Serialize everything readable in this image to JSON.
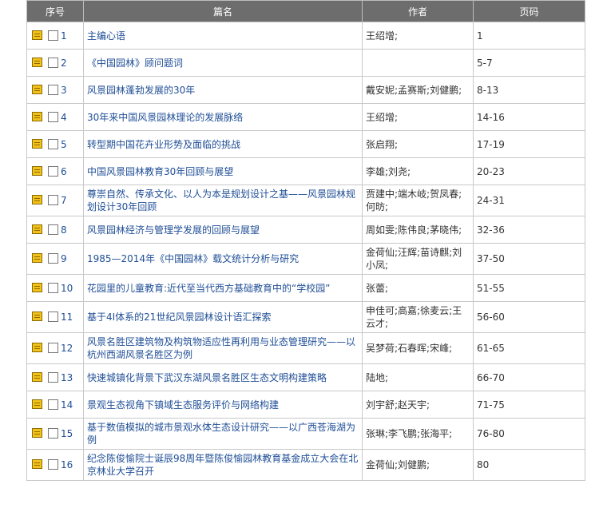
{
  "columns": [
    "序号",
    "篇名",
    "作者",
    "页码"
  ],
  "icons": {
    "row_doc": "document-icon",
    "row_select": "checkbox"
  },
  "rows": [
    {
      "index": "1",
      "title": "主编心语",
      "author": "王绍增;",
      "page": "1"
    },
    {
      "index": "2",
      "title": "《中国园林》顾问题词",
      "author": "",
      "page": "5-7"
    },
    {
      "index": "3",
      "title": "风景园林蓬勃发展的30年",
      "author": "戴安妮;孟赛斯;刘健鹏;",
      "page": "8-13"
    },
    {
      "index": "4",
      "title": "30年来中国风景园林理论的发展脉络",
      "author": "王绍增;",
      "page": "14-16"
    },
    {
      "index": "5",
      "title": "转型期中国花卉业形势及面临的挑战",
      "author": "张启翔;",
      "page": "17-19"
    },
    {
      "index": "6",
      "title": "中国风景园林教育30年回顾与展望",
      "author": "李雄;刘尧;",
      "page": "20-23"
    },
    {
      "index": "7",
      "title": "尊崇自然、传承文化、以人为本是规划设计之基——风景园林规划设计30年回顾",
      "author": "贾建中;端木岐;贺凤春;何昉;",
      "page": "24-31"
    },
    {
      "index": "8",
      "title": "风景园林经济与管理学发展的回顾与展望",
      "author": "周如雯;陈伟良;茅晓伟;",
      "page": "32-36"
    },
    {
      "index": "9",
      "title": "1985—2014年《中国园林》载文统计分析与研究",
      "author": "金荷仙;汪辉;苗诗麒;刘小凤;",
      "page": "37-50"
    },
    {
      "index": "10",
      "title": "花园里的儿童教育:近代至当代西方基础教育中的“学校园”",
      "author": "张蕾;",
      "page": "51-55"
    },
    {
      "index": "11",
      "title": "基于4I体系的21世纪风景园林设计语汇探索",
      "author": "申佳可;高嘉;徐麦云;王云才;",
      "page": "56-60"
    },
    {
      "index": "12",
      "title": "风景名胜区建筑物及构筑物适应性再利用与业态管理研究——以杭州西湖风景名胜区为例",
      "author": "吴梦荷;石春晖;宋峰;",
      "page": "61-65"
    },
    {
      "index": "13",
      "title": "快速城镇化背景下武汉东湖风景名胜区生态文明构建策略",
      "author": "陆地;",
      "page": "66-70"
    },
    {
      "index": "14",
      "title": "景观生态视角下镇域生态服务评价与网络构建",
      "author": "刘宇舒;赵天宇;",
      "page": "71-75"
    },
    {
      "index": "15",
      "title": "基于数值模拟的城市景观水体生态设计研究——以广西苍海湖为例",
      "author": "张琳;李飞鹏;张海平;",
      "page": "76-80"
    },
    {
      "index": "16",
      "title": "纪念陈俊愉院士诞辰98周年暨陈俊愉园林教育基金成立大会在北京林业大学召开",
      "author": "金荷仙;刘健鹏;",
      "page": "80"
    }
  ]
}
